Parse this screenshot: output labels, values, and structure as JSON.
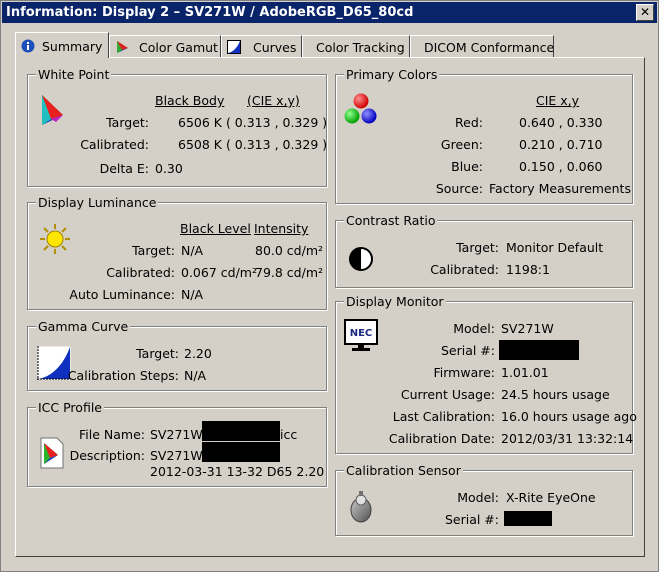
{
  "window": {
    "title": "Information: Display 2 – SV271W / AdobeRGB_D65_80cd",
    "close_glyph": "✕"
  },
  "tabs": [
    {
      "label": "Summary",
      "icon": "info-icon"
    },
    {
      "label": "Color Gamut",
      "icon": "color-gamut-icon"
    },
    {
      "label": "Curves",
      "icon": "curves-icon"
    },
    {
      "label": "Color Tracking"
    },
    {
      "label": "DICOM Conformance"
    }
  ],
  "white_point": {
    "title": "White Point",
    "col1_header": "Black Body",
    "col2_header": "(CIE x,y)",
    "target_label": "Target:",
    "target_value": "6506 K ( 0.313 , 0.329 )",
    "calibrated_label": "Calibrated:",
    "calibrated_value": "6508 K ( 0.313 , 0.329 )",
    "delta_label": "Delta E:",
    "delta_value": "0.30"
  },
  "luminance": {
    "title": "Display Luminance",
    "col1_header": "Black Level",
    "col2_header": "Intensity",
    "target_label": "Target:",
    "target_black": "N/A",
    "target_intensity": "80.0 cd/m²",
    "calibrated_label": "Calibrated:",
    "calibrated_black": "0.067 cd/m²",
    "calibrated_intensity": "79.8 cd/m²",
    "auto_label": "Auto Luminance:",
    "auto_value": "N/A"
  },
  "gamma": {
    "title": "Gamma Curve",
    "target_label": "Target:",
    "target_value": "2.20",
    "steps_label": "Calibration Steps:",
    "steps_value": "N/A"
  },
  "icc": {
    "title": "ICC Profile",
    "file_label": "File Name:",
    "file_prefix": "SV271W",
    "file_suffix": "icc",
    "desc_label": "Description:",
    "desc_prefix": "SV271W",
    "desc_line2": "2012-03-31 13-32 D65 2.20"
  },
  "primaries": {
    "title": "Primary Colors",
    "header": "CIE x,y",
    "red_label": "Red:",
    "red_value": "0.640 , 0.330",
    "green_label": "Green:",
    "green_value": "0.210 , 0.710",
    "blue_label": "Blue:",
    "blue_value": "0.150 , 0.060",
    "source_label": "Source:",
    "source_value": "Factory Measurements"
  },
  "contrast": {
    "title": "Contrast Ratio",
    "target_label": "Target:",
    "target_value": "Monitor Default",
    "calibrated_label": "Calibrated:",
    "calibrated_value": "1198:1"
  },
  "monitor": {
    "title": "Display Monitor",
    "brand_logo": "NEC",
    "model_label": "Model:",
    "model_value": "SV271W",
    "serial_label": "Serial #:",
    "firmware_label": "Firmware:",
    "firmware_value": "1.01.01",
    "usage_label": "Current Usage:",
    "usage_value": "24.5 hours usage",
    "last_cal_label": "Last Calibration:",
    "last_cal_value": "16.0 hours usage ago",
    "cal_date_label": "Calibration Date:",
    "cal_date_value": "2012/03/31 13:32:14"
  },
  "sensor": {
    "title": "Calibration Sensor",
    "model_label": "Model:",
    "model_value": "X-Rite EyeOne",
    "serial_label": "Serial #:"
  },
  "colors": {
    "titlebar": "#0a246a",
    "face": "#d4d0c8"
  }
}
